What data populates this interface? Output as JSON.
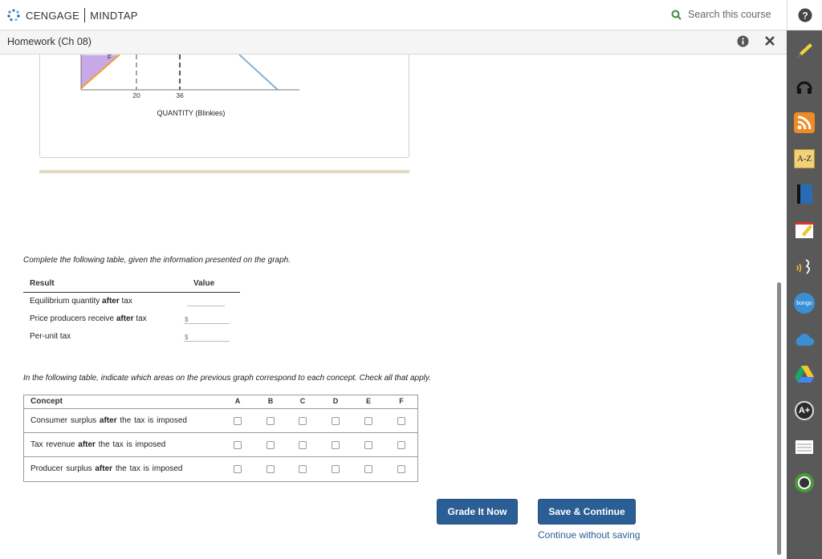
{
  "brand": {
    "name": "CENGAGE",
    "product": "MINDTAP"
  },
  "search": {
    "placeholder": "Search this course"
  },
  "subheader": {
    "title": "Homework (Ch 08)"
  },
  "graph": {
    "region_label": "F",
    "tick_labels": [
      "20",
      "36"
    ],
    "xlabel": "QUANTITY (Blinkies)"
  },
  "colors": {
    "accent": "#2a5e95",
    "sidebar": "#595959",
    "shade": "#c9a8e8",
    "supply_line": "#f0a030",
    "demand_line": "#8ab0d0",
    "tan": "#e2d9c4"
  },
  "instructions1": "Complete the following table, given the information presented on the graph.",
  "results_table": {
    "headers": [
      "Result",
      "Value"
    ],
    "rows": [
      {
        "pre": "Equilibrium quantity ",
        "bold": "after",
        "post": " tax",
        "prefix": "",
        "value": ""
      },
      {
        "pre": "Price producers receive ",
        "bold": "after",
        "post": " tax",
        "prefix": "$",
        "value": ""
      },
      {
        "pre": "Per-unit tax",
        "bold": "",
        "post": "",
        "prefix": "$",
        "value": ""
      }
    ]
  },
  "instructions2": "In the following table, indicate which areas on the previous graph correspond to each concept. Check all that apply.",
  "concept_table": {
    "header": "Concept",
    "columns": [
      "A",
      "B",
      "C",
      "D",
      "E",
      "F"
    ],
    "rows": [
      {
        "pre": "Consumer surplus ",
        "bold": "after",
        "post": " the tax is imposed",
        "checked": [
          false,
          false,
          false,
          false,
          false,
          false
        ]
      },
      {
        "pre": "Tax revenue ",
        "bold": "after",
        "post": " the tax is imposed",
        "checked": [
          false,
          false,
          false,
          false,
          false,
          false
        ]
      },
      {
        "pre": "Producer surplus ",
        "bold": "after",
        "post": " the tax is imposed",
        "checked": [
          false,
          false,
          false,
          false,
          false,
          false
        ]
      }
    ]
  },
  "buttons": {
    "grade": "Grade It Now",
    "save": "Save & Continue",
    "continue": "Continue without saving"
  },
  "sidebar_icons": [
    "help-icon",
    "pencil-icon",
    "headphones-icon",
    "rss-icon",
    "a-z-icon",
    "book-icon",
    "notes-icon",
    "readspeaker-icon",
    "bongo-icon",
    "cloud-icon",
    "drive-icon",
    "aplus-icon",
    "flashcards-icon",
    "profile-icon"
  ],
  "sidebar": {
    "az_label": "A-Z",
    "bongo_label": "bongo",
    "aplus_label": "A+"
  }
}
